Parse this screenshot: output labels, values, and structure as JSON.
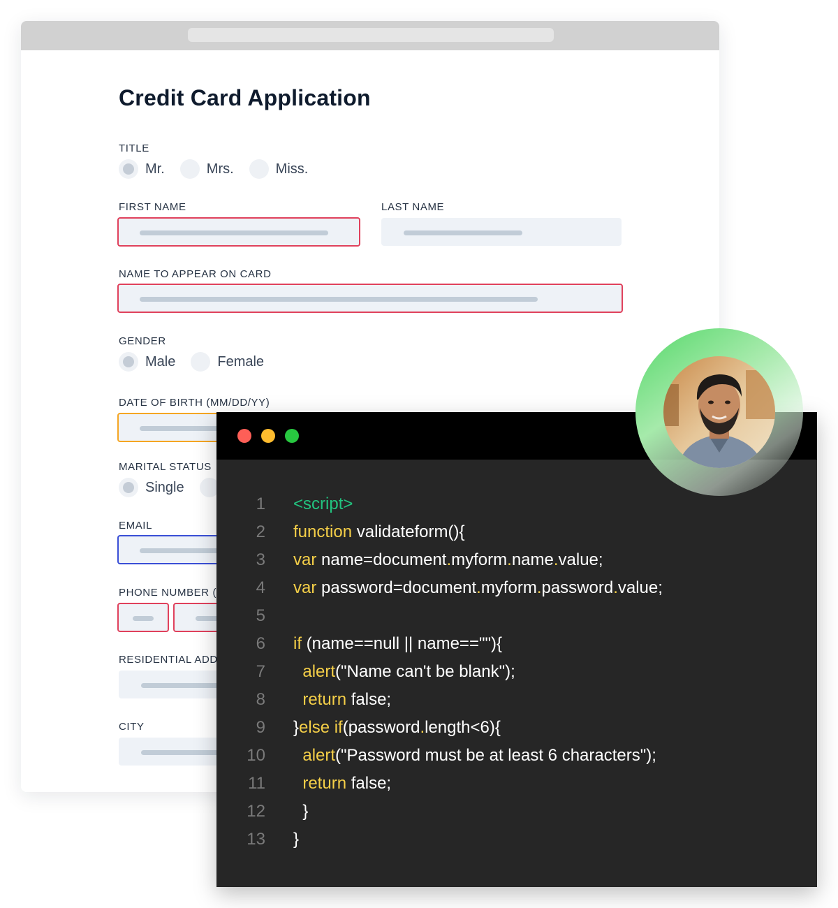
{
  "form": {
    "title": "Credit Card Application",
    "title_label": "TITLE",
    "title_options": [
      "Mr.",
      "Mrs.",
      "Miss."
    ],
    "first_name_label": "FIRST NAME",
    "last_name_label": "LAST NAME",
    "card_name_label": "NAME TO APPEAR ON CARD",
    "gender_label": "GENDER",
    "gender_options": [
      "Male",
      "Female"
    ],
    "dob_label": "DATE OF BIRTH (MM/DD/YY)",
    "marital_label": "MARITAL STATUS",
    "marital_options": [
      "Single"
    ],
    "email_label": "EMAIL",
    "phone_label": "PHONE NUMBER (",
    "address_label": "RESIDENTIAL ADD",
    "city_label": "CITY"
  },
  "editor": {
    "lines": [
      {
        "n": "1",
        "tokens": [
          {
            "t": "tag",
            "v": "<script>"
          }
        ]
      },
      {
        "n": "2",
        "tokens": [
          {
            "t": "kw",
            "v": "function"
          },
          {
            "t": "txt",
            "v": " validateform(){"
          }
        ]
      },
      {
        "n": "3",
        "tokens": [
          {
            "t": "kw",
            "v": "var"
          },
          {
            "t": "txt",
            "v": " name=document"
          },
          {
            "t": "kw",
            "v": "."
          },
          {
            "t": "txt",
            "v": "myform"
          },
          {
            "t": "kw",
            "v": "."
          },
          {
            "t": "txt",
            "v": "name"
          },
          {
            "t": "kw",
            "v": "."
          },
          {
            "t": "txt",
            "v": "value;"
          }
        ]
      },
      {
        "n": "4",
        "tokens": [
          {
            "t": "kw",
            "v": "var"
          },
          {
            "t": "txt",
            "v": " password=document"
          },
          {
            "t": "kw",
            "v": "."
          },
          {
            "t": "txt",
            "v": "myform"
          },
          {
            "t": "kw",
            "v": "."
          },
          {
            "t": "txt",
            "v": "password"
          },
          {
            "t": "kw",
            "v": "."
          },
          {
            "t": "txt",
            "v": "value;"
          }
        ]
      },
      {
        "n": "5",
        "tokens": []
      },
      {
        "n": "6",
        "tokens": [
          {
            "t": "kw",
            "v": "if"
          },
          {
            "t": "txt",
            "v": " (name==null || name==\"\"){"
          }
        ]
      },
      {
        "n": "7",
        "tokens": [
          {
            "t": "txt",
            "v": "  "
          },
          {
            "t": "kw",
            "v": "alert"
          },
          {
            "t": "txt",
            "v": "(\"Name can't be blank\");"
          }
        ]
      },
      {
        "n": "8",
        "tokens": [
          {
            "t": "txt",
            "v": "  "
          },
          {
            "t": "kw",
            "v": "return"
          },
          {
            "t": "txt",
            "v": " false;"
          }
        ]
      },
      {
        "n": "9",
        "tokens": [
          {
            "t": "txt",
            "v": "}"
          },
          {
            "t": "kw",
            "v": "else if"
          },
          {
            "t": "txt",
            "v": "(password"
          },
          {
            "t": "kw",
            "v": "."
          },
          {
            "t": "txt",
            "v": "length<6){"
          }
        ]
      },
      {
        "n": "10",
        "tokens": [
          {
            "t": "txt",
            "v": "  "
          },
          {
            "t": "kw",
            "v": "alert"
          },
          {
            "t": "txt",
            "v": "(\"Password must be at least 6 characters\");"
          }
        ]
      },
      {
        "n": "11",
        "tokens": [
          {
            "t": "txt",
            "v": "  "
          },
          {
            "t": "kw",
            "v": "return"
          },
          {
            "t": "txt",
            "v": " false;"
          }
        ]
      },
      {
        "n": "12",
        "tokens": [
          {
            "t": "txt",
            "v": "  }"
          }
        ]
      },
      {
        "n": "13",
        "tokens": [
          {
            "t": "txt",
            "v": "}"
          }
        ]
      }
    ]
  },
  "colors": {
    "keyword": "#f5cf48",
    "tag": "#22c37f",
    "error_border": "#e0415c",
    "warning_border": "#f5a623",
    "focus_border": "#3a4fd6"
  }
}
